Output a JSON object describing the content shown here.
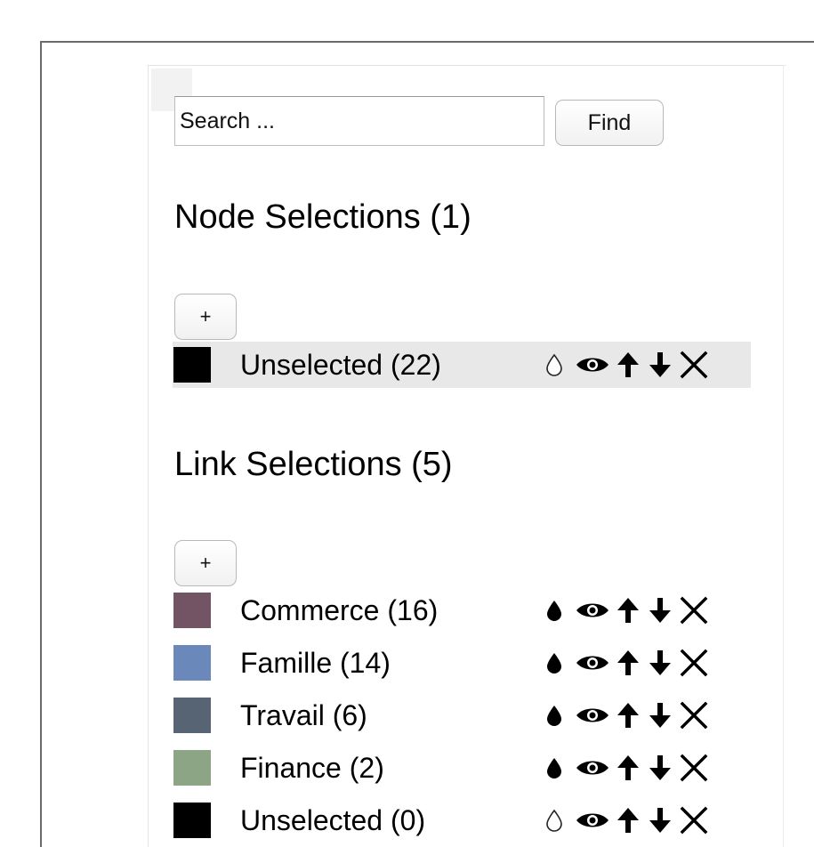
{
  "search": {
    "placeholder": "Search ...",
    "find_label": "Find"
  },
  "node_selections": {
    "heading": "Node Selections (1)",
    "add_label": "+",
    "items": [
      {
        "label": "Unselected (22)",
        "color": "#000000",
        "drop": "outline",
        "highlighted": true
      }
    ]
  },
  "link_selections": {
    "heading": "Link Selections (5)",
    "add_label": "+",
    "items": [
      {
        "label": "Commerce (16)",
        "color": "#735464",
        "drop": "filled"
      },
      {
        "label": "Famille (14)",
        "color": "#6a88ba",
        "drop": "filled"
      },
      {
        "label": "Travail (6)",
        "color": "#576473",
        "drop": "filled"
      },
      {
        "label": "Finance (2)",
        "color": "#8ca585",
        "drop": "filled"
      },
      {
        "label": "Unselected (0)",
        "color": "#000000",
        "drop": "outline"
      }
    ]
  },
  "icons": [
    "drop-icon",
    "eye-icon",
    "arrow-up-icon",
    "arrow-down-icon",
    "close-icon"
  ]
}
